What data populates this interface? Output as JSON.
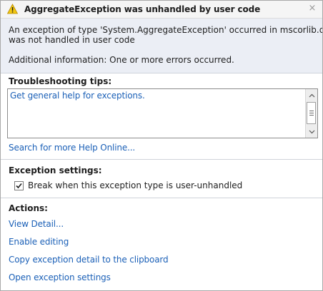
{
  "dialog": {
    "title": "AggregateException was unhandled by user code",
    "close_glyph": "×"
  },
  "message": {
    "line1": "An exception of type 'System.AggregateException' occurred in mscorlib.dll but",
    "line2": "was not handled in user code",
    "additional": "Additional information: One or more errors occurred."
  },
  "troubleshooting": {
    "heading": "Troubleshooting tips:",
    "tip_link": "Get general help for exceptions.",
    "search_link": "Search for more Help Online..."
  },
  "exception_settings": {
    "heading": "Exception settings:",
    "checkbox_label": "Break when this exception type is user-unhandled",
    "checked": true
  },
  "actions": {
    "heading": "Actions:",
    "items": [
      "View Detail...",
      "Enable editing",
      "Copy exception detail to the clipboard",
      "Open exception settings"
    ]
  },
  "colors": {
    "link": "#1b60b7",
    "message_bg": "#ebeef5",
    "warning": "#f2c811"
  }
}
